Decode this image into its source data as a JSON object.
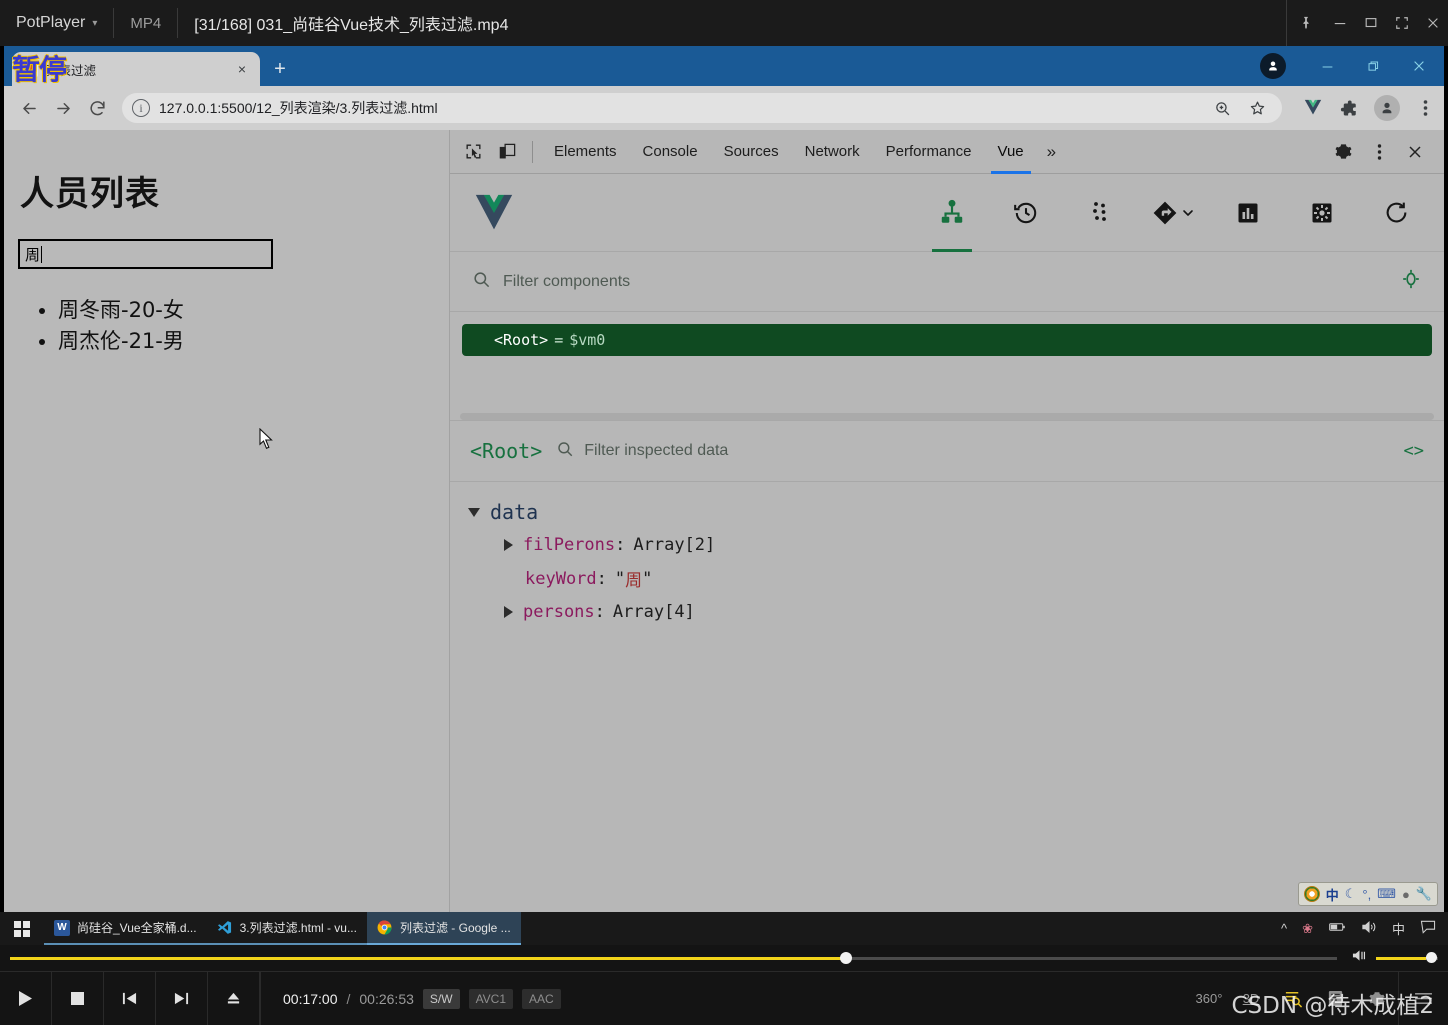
{
  "potplayer": {
    "app_name": "PotPlayer",
    "format_label": "MP4",
    "video_title": "[31/168] 031_尚硅谷Vue技术_列表过滤.mp4",
    "osd_status": "暂停",
    "window_buttons": [
      "pin-icon",
      "minimize-icon",
      "maximize-icon",
      "fullscreen-icon",
      "close-icon"
    ],
    "transport": {
      "play_label": "play-icon",
      "stop_label": "stop-icon",
      "prev_label": "previous-icon",
      "next_label": "next-icon",
      "eject_label": "eject-icon"
    },
    "time": {
      "current": "00:17:00",
      "separator": "/",
      "total": "00:26:53"
    },
    "badges": [
      "S/W",
      "AVC1",
      "AAC"
    ],
    "right_buttons": [
      "360°",
      "3D",
      "playlist-search-icon",
      "playlist-icon",
      "settings-icon",
      "menu-icon"
    ],
    "seek_percent": 63,
    "volume_percent": 80,
    "watermark": "CSDN @待木成植2"
  },
  "chrome": {
    "tab": {
      "title": "列表过滤",
      "close_label": "×",
      "favicon": "chrome-page-icon"
    },
    "new_tab_label": "+",
    "window_buttons": [
      "minimize-icon",
      "restore-icon",
      "close-icon"
    ],
    "profile_badge": "profile-avatar-icon",
    "nav": {
      "back_label": "back-arrow-icon",
      "forward_label": "forward-arrow-icon",
      "reload_label": "reload-icon"
    },
    "omnibox": {
      "info_icon": "page-info-icon",
      "url": "127.0.0.1:5500/12_列表渲染/3.列表过滤.html",
      "zoom_icon": "zoom-icon",
      "bookmark_icon": "star-icon"
    },
    "extensions": [
      "vue-devtools-extension-icon",
      "extensions-puzzle-icon",
      "profile-icon",
      "chrome-menu-icon"
    ]
  },
  "page": {
    "heading": "人员列表",
    "search_value": "周",
    "search_placeholder": "",
    "list": [
      "周冬雨-20-女",
      "周杰伦-21-男"
    ]
  },
  "devtools": {
    "left_icons": [
      "inspect-element-icon",
      "device-toolbar-icon"
    ],
    "tabs": [
      {
        "label": "Elements",
        "active": false
      },
      {
        "label": "Console",
        "active": false
      },
      {
        "label": "Sources",
        "active": false
      },
      {
        "label": "Network",
        "active": false
      },
      {
        "label": "Performance",
        "active": false
      },
      {
        "label": "Vue",
        "active": true
      }
    ],
    "more_tabs_label": "»",
    "right_icons": [
      "devtools-settings-gear-icon",
      "devtools-more-icon",
      "devtools-close-icon"
    ],
    "vue": {
      "logo": "vue-logo-icon",
      "toolbar": [
        {
          "name": "components-tree-icon",
          "active": true
        },
        {
          "name": "timeline-history-icon",
          "active": false
        },
        {
          "name": "vuex-state-icon",
          "active": false
        },
        {
          "name": "routes-icon",
          "active": false
        },
        {
          "name": "performance-chart-icon",
          "active": false
        },
        {
          "name": "plugin-settings-icon",
          "active": false
        },
        {
          "name": "refresh-icon",
          "active": false
        }
      ],
      "filter_components_placeholder": "Filter components",
      "select_component_icon": "select-component-target-icon",
      "tree": [
        {
          "tag": "<Root>",
          "equals": "=",
          "instance": "$vm0",
          "selected": true
        }
      ],
      "inspector": {
        "component_name": "<Root>",
        "filter_placeholder": "Filter inspected data",
        "edit_icon": "<>",
        "groups": [
          {
            "name": "data",
            "expanded": true,
            "rows": [
              {
                "key": "filPerons",
                "value": "Array[2]",
                "type": "array",
                "expandable": true
              },
              {
                "key": "keyWord",
                "value": "周",
                "type": "string",
                "expandable": false
              },
              {
                "key": "persons",
                "value": "Array[4]",
                "type": "array",
                "expandable": true
              }
            ]
          }
        ]
      }
    }
  },
  "ime": {
    "items": [
      "sogou-logo-icon",
      "中",
      "moon-icon",
      "punctuation-icon",
      "keyboard-icon",
      "user-icon",
      "toolbox-icon"
    ]
  },
  "taskbar": {
    "start_label": "windows-start-icon",
    "items": [
      {
        "label": "尚硅谷_Vue全家桶.d...",
        "icon": "word-icon",
        "icon_color": "#2b579a",
        "glyph": "W",
        "active": false
      },
      {
        "label": "3.列表过滤.html - vu...",
        "icon": "vscode-icon",
        "icon_color": "#0f6cbd",
        "glyph": "⬡",
        "active": false
      },
      {
        "label": "列表过滤 - Google ...",
        "icon": "chrome-icon",
        "icon_color": "#f4b400",
        "glyph": "●",
        "active": true
      }
    ],
    "tray": [
      "show-hidden-icons-chevron",
      "flower-icon",
      "battery-icon",
      "volume-icon",
      "中",
      "notifications-icon"
    ]
  }
}
